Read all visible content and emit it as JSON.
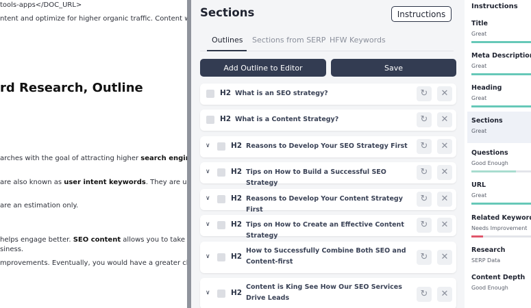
{
  "editor": {
    "line1": "tools-apps</DOC_URL>",
    "line2": "ntent and optimize for higher organic traffic. Content writing",
    "heading": "rd Research, Outline",
    "para1": {
      "before": "arches with the goal of attracting higher ",
      "bold": "search engine"
    },
    "para2": {
      "before": "are also known as ",
      "bold": "user intent keywords",
      "after": ". They are usually"
    },
    "para3": " are an estimation only.",
    "para4": {
      "before": "helps engage better. ",
      "bold": "SEO content",
      "after": " allows you to take"
    },
    "para5": "siness.",
    "para6": "mprovements. Eventually, you would have a greater chance"
  },
  "panel": {
    "title": "Sections",
    "instructions_label": "Instructions",
    "tabs": [
      "Outlines",
      "Sections from SERP",
      "HFW Keywords"
    ],
    "add_outline_label": "Add Outline to Editor",
    "save_label": "Save",
    "sections": [
      {
        "tag": "H2",
        "title": "What is an SEO strategy?",
        "expandable": false
      },
      {
        "tag": "H2",
        "title": "What is a Content Strategy?",
        "expandable": false
      },
      {
        "tag": "H2",
        "title": "Reasons to Develop Your SEO Strategy First",
        "expandable": true
      },
      {
        "tag": "H2",
        "title": "Tips on How to Build a Successful SEO Strategy",
        "expandable": true
      },
      {
        "tag": "H2",
        "title": "Reasons to Develop Your Content Strategy First",
        "expandable": true
      },
      {
        "tag": "H2",
        "title": "Tips on How to Create an Effective Content Strategy",
        "expandable": true
      },
      {
        "tag": "H2",
        "title": "How to Successfully Combine Both SEO and Content-first",
        "expandable": true
      },
      {
        "tag": "H2",
        "title": "Content is King See How Our SEO Services Drive Leads",
        "expandable": true
      }
    ]
  },
  "sidebar": {
    "title": "Instructions",
    "items": [
      {
        "label": "Title",
        "status": "Great",
        "score": 1.0,
        "color": "#66c8b8"
      },
      {
        "label": "Meta Description",
        "status": "Great",
        "score": 1.0,
        "color": "#66c8b8"
      },
      {
        "label": "Heading",
        "status": "Great",
        "score": 1.0,
        "color": "#66c8b8"
      },
      {
        "label": "Sections",
        "status": "Great",
        "score": 1.0,
        "color": "#66c8b8"
      },
      {
        "label": "Questions",
        "status": "Good Enough",
        "score": 0.75,
        "color": "#a8dccf"
      },
      {
        "label": "URL",
        "status": "Great",
        "score": 1.0,
        "color": "#66c8b8"
      },
      {
        "label": "Related Keywords",
        "status": "Needs Improvement",
        "score": 0.2,
        "color": "#e0566b"
      },
      {
        "label": "Research",
        "status": "SERP Data",
        "score": 0,
        "color": "#66c8b8"
      },
      {
        "label": "Content Depth",
        "status": "Good Enough",
        "score": 0.75,
        "color": "#a8dccf"
      }
    ]
  }
}
